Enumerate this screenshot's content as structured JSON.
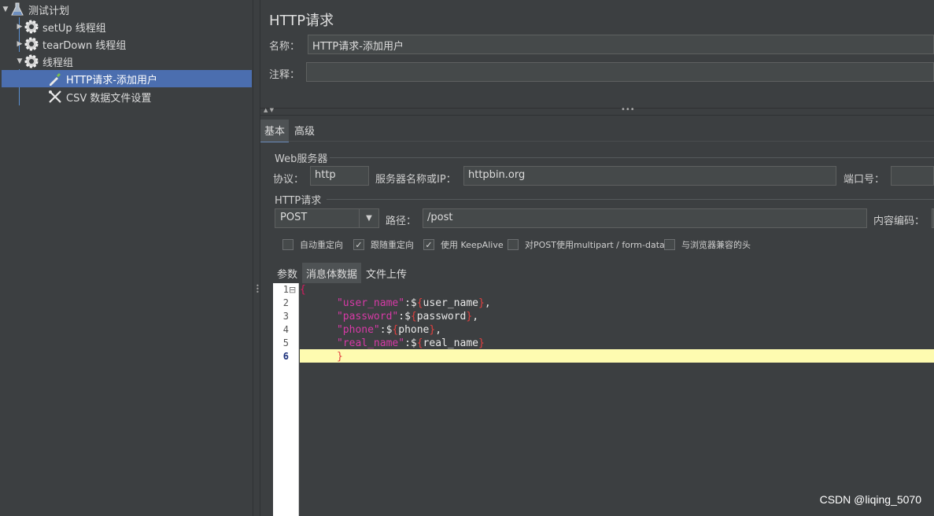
{
  "tree": {
    "items": [
      {
        "label": "测试计划",
        "icon": "flask-icon",
        "expanded": true
      },
      {
        "label": "setUp 线程组",
        "icon": "gear-icon",
        "expanded": false
      },
      {
        "label": "tearDown 线程组",
        "icon": "gear-icon",
        "expanded": false
      },
      {
        "label": "线程组",
        "icon": "gear-icon",
        "expanded": true
      },
      {
        "label": "HTTP请求-添加用户",
        "icon": "pipette-icon",
        "selected": true
      },
      {
        "label": "CSV 数据文件设置",
        "icon": "tools-icon"
      }
    ]
  },
  "panel": {
    "title": "HTTP请求",
    "name_label": "名称：",
    "name_value": "HTTP请求-添加用户",
    "comment_label": "注释：",
    "comment_value": "",
    "tabs": [
      "基本",
      "高级"
    ],
    "web_server_group": "Web服务器",
    "protocol_label": "协议：",
    "protocol_value": "http",
    "server_label": "服务器名称或IP：",
    "server_value": "httpbin.org",
    "port_label": "端口号：",
    "port_value": "",
    "http_group": "HTTP请求",
    "method_value": "POST",
    "path_label": "路径：",
    "path_value": "/post",
    "encoding_label": "内容编码：",
    "checkboxes": [
      {
        "label": "自动重定向",
        "checked": false
      },
      {
        "label": "跟随重定向",
        "checked": true
      },
      {
        "label": "使用 KeepAlive",
        "checked": true
      },
      {
        "label": "对POST使用multipart / form-data",
        "checked": false
      },
      {
        "label": "与浏览器兼容的头",
        "checked": false
      }
    ],
    "sub_tabs": [
      "参数",
      "消息体数据",
      "文件上传"
    ]
  },
  "editor": {
    "line_numbers": [
      "1",
      "2",
      "3",
      "4",
      "5",
      "6"
    ],
    "lines": [
      {
        "open": "{"
      },
      {
        "key": "\"user_name\"",
        "sep": ":",
        "dollar": "$",
        "lb": "{",
        "var": "user_name",
        "rb": "}",
        "end": ","
      },
      {
        "key": "\"password\"",
        "sep": ":",
        "dollar": "$",
        "lb": "{",
        "var": "password",
        "rb": "}",
        "end": ","
      },
      {
        "key": "\"phone\"",
        "sep": ":",
        "dollar": "$",
        "lb": "{",
        "var": "phone",
        "rb": "}",
        "end": ","
      },
      {
        "key": "\"real_name\"",
        "sep": ":",
        "dollar": "$",
        "lb": "{",
        "var": "real_name",
        "rb": "}",
        "end": ""
      },
      {
        "close": "}"
      }
    ],
    "fold_marker": "⊟"
  },
  "watermark": "CSDN @liqing_5070"
}
